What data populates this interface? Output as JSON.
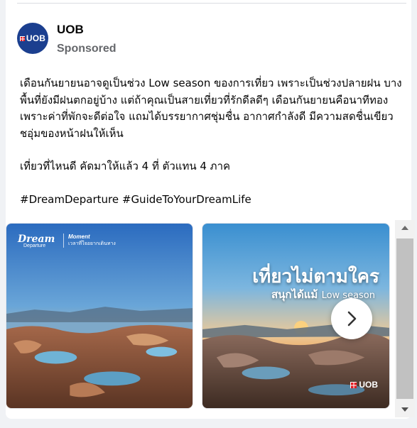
{
  "post": {
    "page_name": "UOB",
    "avatar_text": "UOB",
    "sponsored_label": "Sponsored",
    "paragraphs": [
      "เดือนกันยายนอาจดูเป็นช่วง Low season ของการเที่ยว เพราะเป็นช่วงปลายฝน บางพื้นที่ยังมีฝนตกอยู่บ้าง แต่ถ้าคุณเป็นสายเที่ยวที่รักดีลดีๆ เดือนกันยายนคือนาทีทอง เพราะค่าที่พักจะดีต่อใจ แถมได้บรรยากาศชุ่มชื่น อากาศกำลังดี มีความสดชื่นเขียวชอุ่มของหน้าฝนให้เห็น",
      "เที่ยวที่ไหนดี คัดมาให้แล้ว 4 ที่ ตัวแทน 4 ภาค",
      "#DreamDeparture #GuideToYourDreamLife"
    ]
  },
  "carousel": {
    "slide1": {
      "logo_line1": "Dream",
      "logo_line2": "Departure",
      "moment_title": "Moment",
      "moment_subtitle": "เวลาที่ใจอยากเดินทาง"
    },
    "slide2": {
      "headline": "เที่ยวไม่ตามใคร",
      "sub_main": "สนุกได้แม้",
      "sub_small": "Low season",
      "brand": "UOB"
    },
    "next_icon": "chevron-right-icon"
  },
  "scrollbar": {
    "up_icon": "triangle-up-icon",
    "down_icon": "triangle-down-icon"
  },
  "colors": {
    "brand_blue": "#1b3f8f",
    "brand_red": "#e11b22",
    "secondary_text": "#65676b"
  }
}
